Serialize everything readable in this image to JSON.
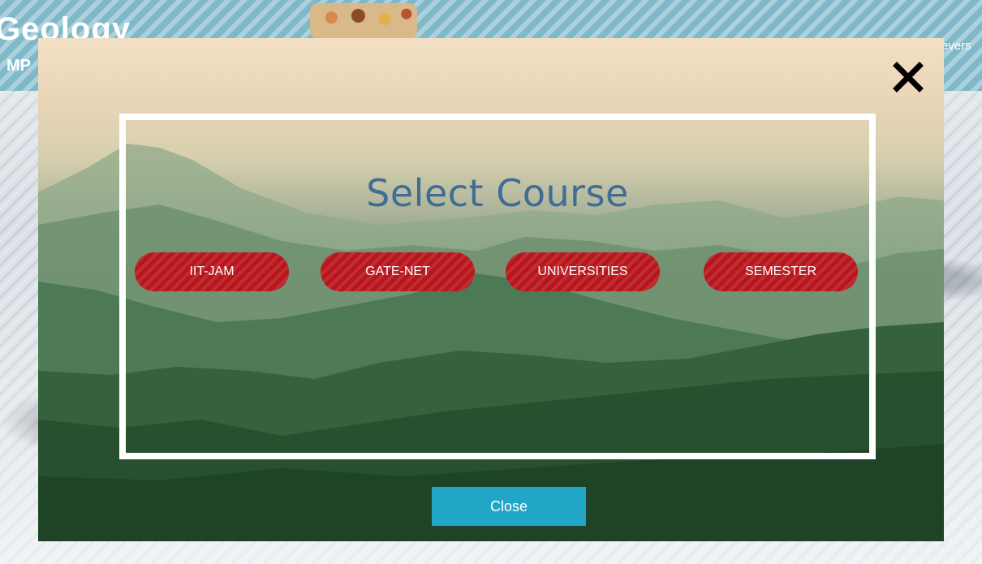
{
  "background": {
    "logo_text": "Geology",
    "sub_text": "MP",
    "right_text": "evers"
  },
  "modal": {
    "title": "Select Course",
    "courses": [
      {
        "label": "IIT-JAM"
      },
      {
        "label": "GATE-NET"
      },
      {
        "label": "UNIVERSITIES"
      },
      {
        "label": "SEMESTER"
      }
    ],
    "close_label": "Close",
    "close_icon": "close-x-icon"
  },
  "colors": {
    "title": "#3f6d96",
    "course_button": "#b8161c",
    "close_button": "#22a6c8",
    "frame": "#ffffff"
  }
}
